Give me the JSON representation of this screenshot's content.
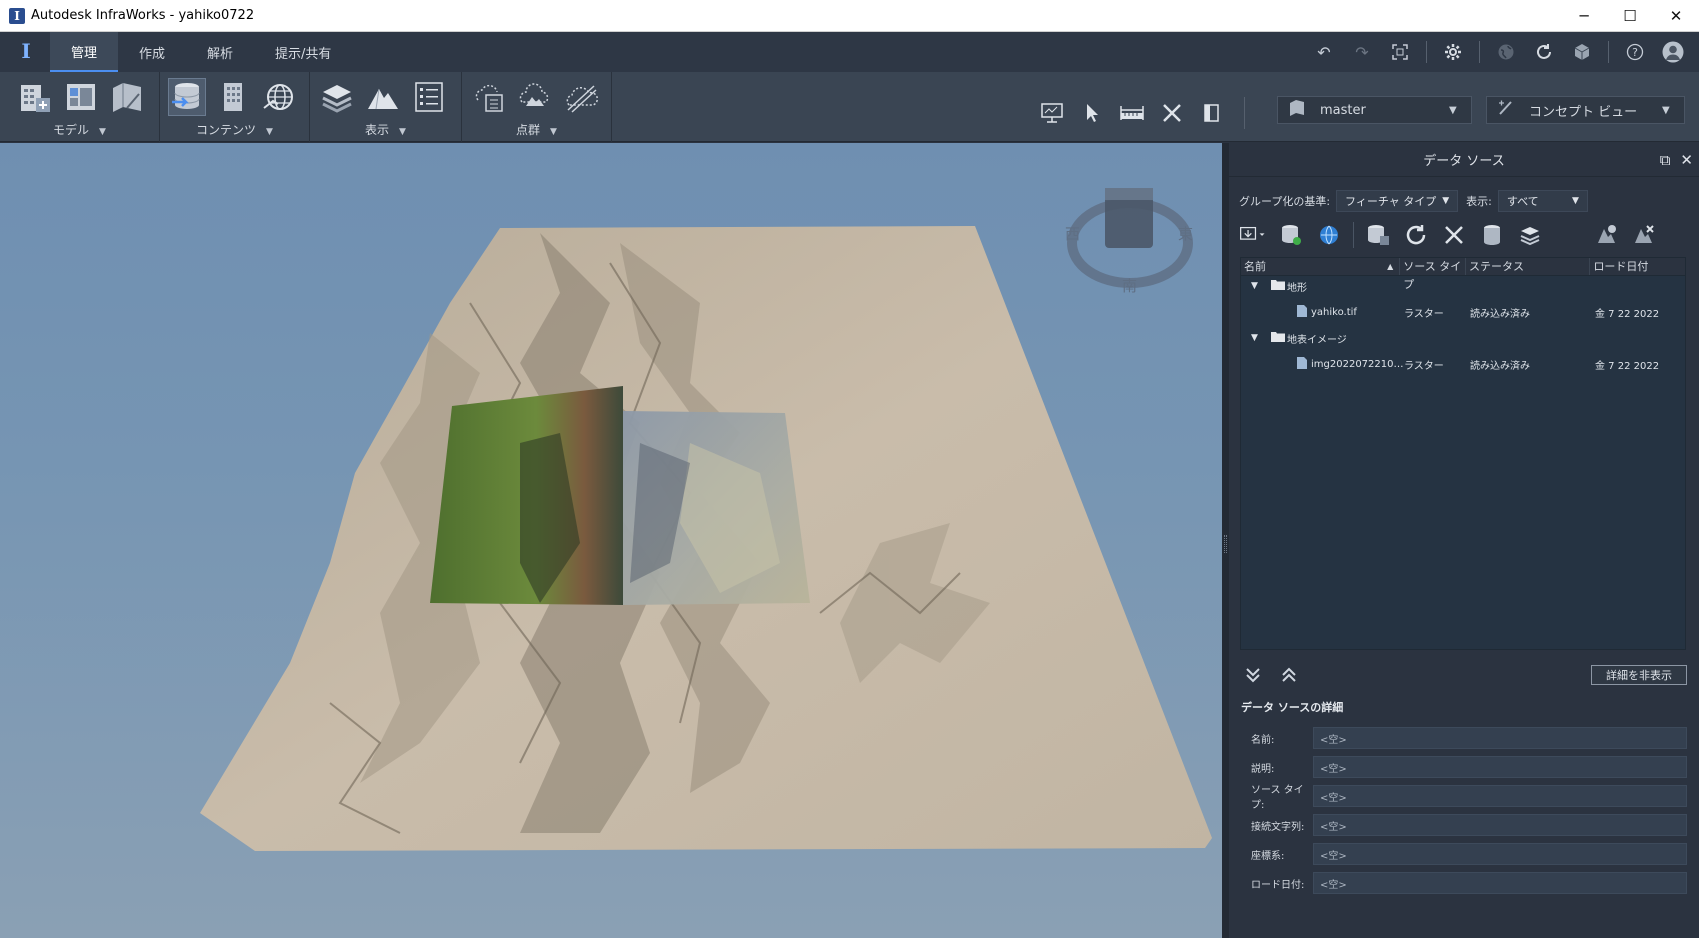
{
  "window": {
    "title": "Autodesk InfraWorks - yahiko0722",
    "controls": {
      "minimize": "─",
      "maximize": "☐",
      "close": "✕"
    }
  },
  "ribbon_tabs": [
    "管理",
    "作成",
    "解析",
    "提示/共有"
  ],
  "ribbon_groups": {
    "model": "モデル",
    "content": "コンテンツ",
    "display": "表示",
    "point_cloud": "点群"
  },
  "combos": {
    "branch": "master",
    "view": "コンセプト ビュー"
  },
  "viewcube": {
    "west": "西",
    "east": "東",
    "south": "南"
  },
  "panel": {
    "title": "データ ソース",
    "group_by_label": "グループ化の基準:",
    "group_by_value": "フィーチャ タイプ",
    "show_label": "表示:",
    "show_value": "すべて",
    "columns": [
      "名前",
      "ソース タイプ",
      "ステータス",
      "ロード日付"
    ],
    "tree": [
      {
        "label": "地形",
        "children": [
          {
            "name": "yahiko.tif",
            "type": "ラスター",
            "status": "読み込み済み",
            "date": "金 7 22 2022"
          }
        ]
      },
      {
        "label": "地表イメージ",
        "children": [
          {
            "name": "img2022072210…",
            "type": "ラスター",
            "status": "読み込み済み",
            "date": "金 7 22 2022"
          }
        ]
      }
    ],
    "hide_details_button": "詳細を非表示",
    "details_title": "データ ソースの詳細",
    "details": [
      {
        "label": "名前:",
        "value": "<空>"
      },
      {
        "label": "説明:",
        "value": "<空>"
      },
      {
        "label": "ソース タイプ:",
        "value": "<空>"
      },
      {
        "label": "接続文字列:",
        "value": "<空>"
      },
      {
        "label": "座標系:",
        "value": "<空>"
      },
      {
        "label": "ロード日付:",
        "value": "<空>"
      }
    ]
  },
  "colors": {
    "accent": "#4b8ef0",
    "terrain": "#c2b6a3",
    "sky_top": "#6f8fb1"
  }
}
